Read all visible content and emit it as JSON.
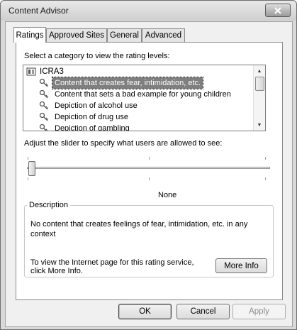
{
  "window": {
    "title": "Content Advisor"
  },
  "tabs": [
    {
      "label": "Ratings",
      "active": true
    },
    {
      "label": "Approved Sites",
      "active": false
    },
    {
      "label": "General",
      "active": false
    },
    {
      "label": "Advanced",
      "active": false
    }
  ],
  "ratings": {
    "select_prompt": "Select a category to view the rating levels:",
    "service": {
      "name": "ICRA3",
      "icon": "rating-service-icon"
    },
    "categories": [
      {
        "label": "Content that creates fear, intimidation, etc.",
        "icon": "key-icon",
        "selected": true
      },
      {
        "label": "Content that sets a bad example for young children",
        "icon": "key-icon",
        "selected": false
      },
      {
        "label": "Depiction of alcohol use",
        "icon": "key-icon",
        "selected": false
      },
      {
        "label": "Depiction of drug use",
        "icon": "key-icon",
        "selected": false
      },
      {
        "label": "Depiction of gambling",
        "icon": "key-icon",
        "selected": false
      }
    ],
    "slider_prompt": "Adjust the slider to specify what users are allowed to see:",
    "slider_level": 0,
    "slider_value_label": "None",
    "description": {
      "heading": "Description",
      "text": "No content that creates feelings of fear, intimidation, etc. in any context",
      "info_text": "To view the Internet page for this rating service, click More Info.",
      "more_info_label": "More Info"
    }
  },
  "footer": {
    "ok_label": "OK",
    "cancel_label": "Cancel",
    "apply_label": "Apply"
  }
}
